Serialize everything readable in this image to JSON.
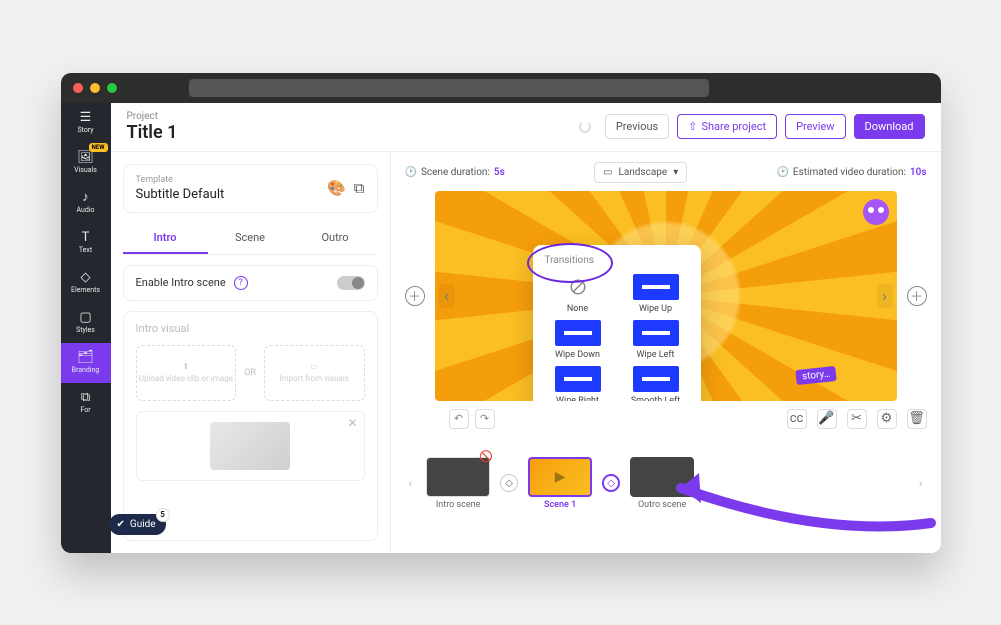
{
  "sidebar": {
    "items": [
      {
        "label": "Story",
        "icon": "☰"
      },
      {
        "label": "Visuals",
        "icon": "🖼",
        "new": true,
        "new_text": "NEW"
      },
      {
        "label": "Audio",
        "icon": "♪"
      },
      {
        "label": "Text",
        "icon": "T"
      },
      {
        "label": "Elements",
        "icon": "◇"
      },
      {
        "label": "Styles",
        "icon": "▢"
      },
      {
        "label": "Branding",
        "icon": "🗂",
        "active": true
      },
      {
        "label": "For",
        "icon": "⧉"
      }
    ]
  },
  "header": {
    "crumb": "Project",
    "title": "Title 1",
    "previous": "Previous",
    "share": "Share project",
    "preview": "Preview",
    "download": "Download"
  },
  "template_card": {
    "label": "Template",
    "name": "Subtitle Default"
  },
  "tabs": [
    {
      "label": "Intro",
      "active": true
    },
    {
      "label": "Scene"
    },
    {
      "label": "Outro"
    }
  ],
  "enable_intro": {
    "label": "Enable Intro scene"
  },
  "intro_visual": {
    "heading": "Intro visual",
    "upload_label": "Upload video clip or image",
    "or": "OR",
    "import_label": "Import from visuals"
  },
  "meta": {
    "scene_duration_label": "Scene duration:",
    "scene_duration_value": "5s",
    "orientation": "Landscape",
    "est_label": "Estimated video duration:",
    "est_value": "10s"
  },
  "canvas": {
    "story_chip": "story…"
  },
  "transitions_popover": {
    "title": "Transitions",
    "items": [
      {
        "label": "None",
        "none": true
      },
      {
        "label": "Wipe Up"
      },
      {
        "label": "Wipe Down"
      },
      {
        "label": "Wipe Left"
      },
      {
        "label": "Wipe Right"
      },
      {
        "label": "Smooth Left"
      }
    ]
  },
  "timeline": {
    "scenes": [
      {
        "label": "Intro scene"
      },
      {
        "label": "Scene 1",
        "active": true
      },
      {
        "label": "Outro scene"
      }
    ]
  },
  "guide": {
    "label": "Guide",
    "count": "5"
  },
  "colors": {
    "accent": "#7c3aed"
  }
}
